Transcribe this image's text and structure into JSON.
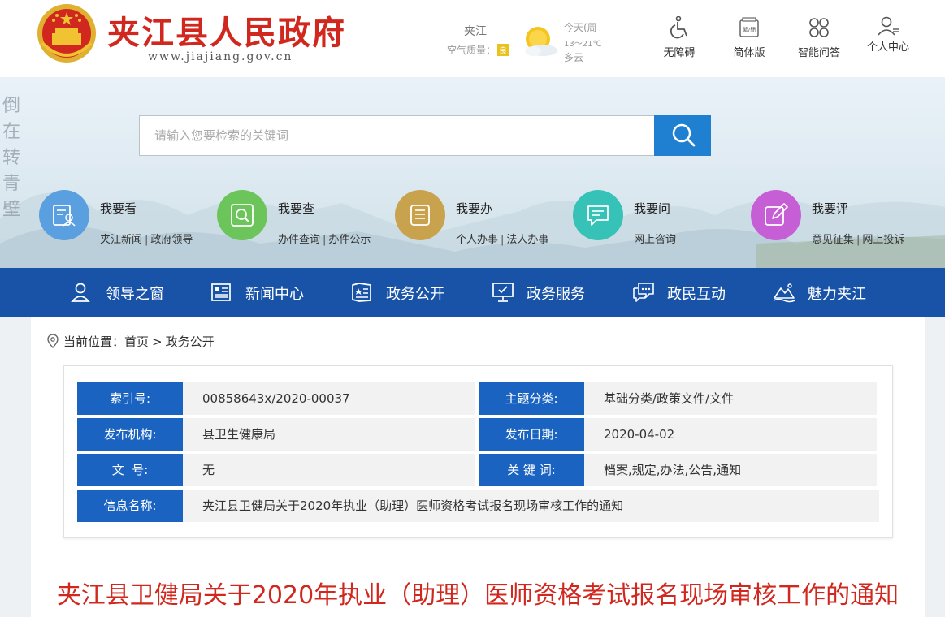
{
  "header": {
    "title": "夹江县人民政府",
    "url": "www.jiajiang.gov.cn",
    "weather": {
      "city": "夹江",
      "air_quality_label": "空气质量：",
      "air_quality_value": "良",
      "today": "今天(周",
      "temp": "13～21℃",
      "condition": "多云"
    },
    "tools": [
      {
        "label": "无障碍",
        "icon": "wheelchair-icon"
      },
      {
        "label": "简体版",
        "icon": "simplified-icon"
      },
      {
        "label": "智能问答",
        "icon": "qa-icon"
      },
      {
        "label": "个人中心",
        "icon": "user-icon"
      }
    ]
  },
  "banner": {
    "calligraphy": "倒在转青壁",
    "search_placeholder": "请输入您要检索的关键词",
    "quick": [
      {
        "title": "我要看",
        "links": [
          "夹江新闻",
          "政府领导"
        ],
        "color": "#5a9fe0",
        "icon": "view-icon"
      },
      {
        "title": "我要查",
        "links": [
          "办件查询",
          "办件公示"
        ],
        "color": "#6cc55a",
        "icon": "query-icon"
      },
      {
        "title": "我要办",
        "links": [
          "个人办事",
          "法人办事"
        ],
        "color": "#c9a24d",
        "icon": "handle-icon"
      },
      {
        "title": "我要问",
        "links": [
          "网上咨询"
        ],
        "color": "#37c2b8",
        "icon": "ask-icon"
      },
      {
        "title": "我要评",
        "links": [
          "意见征集",
          "网上投诉"
        ],
        "color": "#c65fd6",
        "icon": "comment-icon"
      }
    ]
  },
  "nav": [
    {
      "label": "领导之窗",
      "icon": "leader-icon"
    },
    {
      "label": "新闻中心",
      "icon": "news-icon"
    },
    {
      "label": "政务公开",
      "icon": "open-gov-icon"
    },
    {
      "label": "政务服务",
      "icon": "service-icon"
    },
    {
      "label": "政民互动",
      "icon": "interaction-icon"
    },
    {
      "label": "魅力夹江",
      "icon": "charm-icon"
    }
  ],
  "breadcrumb": {
    "prefix": "当前位置：",
    "items": [
      "首页",
      "政务公开"
    ],
    "sep": ">"
  },
  "meta": {
    "index_label": "索引号:",
    "index_value": "00858643x/2020-00037",
    "category_label": "主题分类:",
    "category_value": "基础分类/政策文件/文件",
    "org_label": "发布机构:",
    "org_value": "县卫生健康局",
    "date_label": "发布日期:",
    "date_value": "2020-04-02",
    "docno_label": "文  号:",
    "docno_value": "无",
    "keywords_label": "关 键 词:",
    "keywords_value": "档案,规定,办法,公告,通知",
    "name_label": "信息名称:",
    "name_value": "夹江县卫健局关于2020年执业（助理）医师资格考试报名现场审核工作的通知"
  },
  "doc_title": "夹江县卫健局关于2020年执业（助理）医师资格考试报名现场审核工作的通知",
  "colors": {
    "brand_red": "#d0281e",
    "nav_blue": "#1953a8",
    "label_blue": "#1a63c0",
    "search_blue": "#1f7fd1"
  }
}
